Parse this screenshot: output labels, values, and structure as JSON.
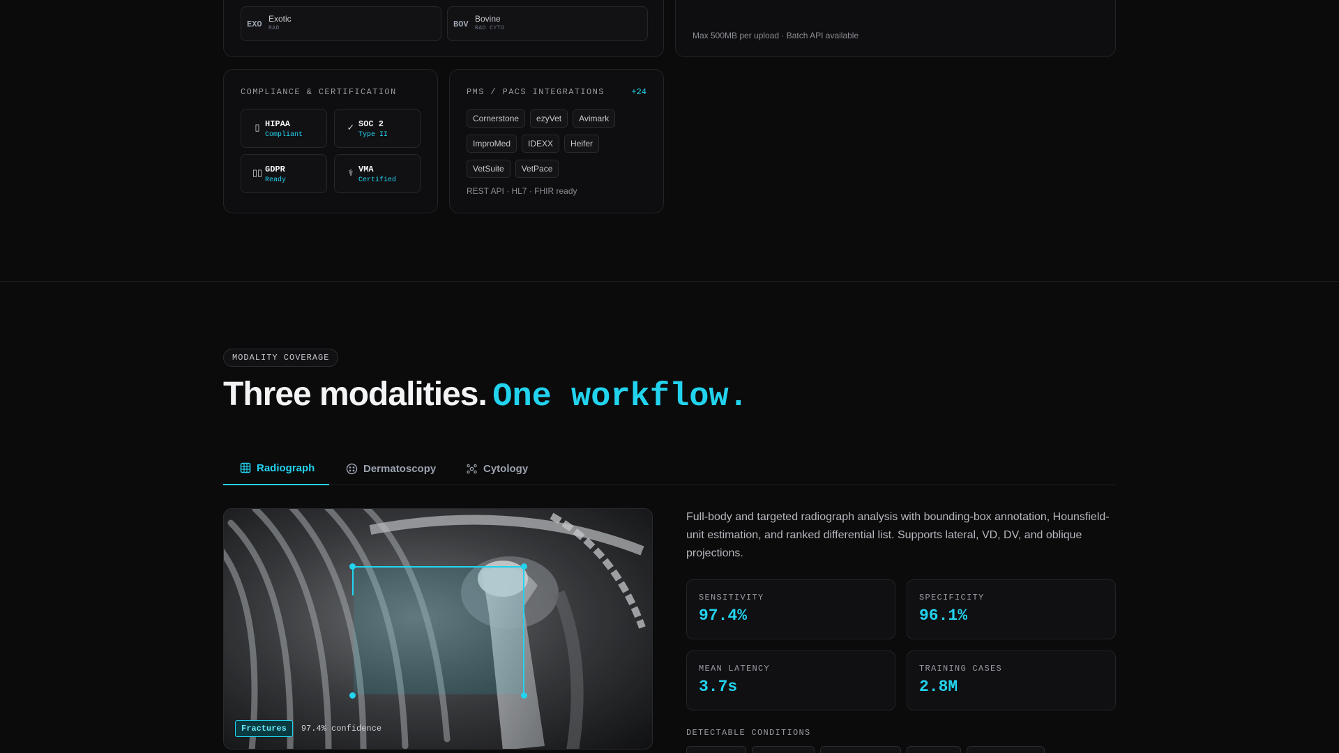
{
  "species": [
    {
      "code": "EXO",
      "name": "Exotic",
      "sub": "RAD"
    },
    {
      "code": "BOV",
      "name": "Bovine",
      "sub": "RAD CYTO"
    }
  ],
  "upload_note": "Max 500MB per upload · Batch API available",
  "compliance": {
    "title": "COMPLIANCE & CERTIFICATION",
    "badges": [
      {
        "icon": "▯",
        "name": "HIPAA",
        "status": "Compliant"
      },
      {
        "icon": "✓",
        "name": "SOC 2",
        "status": "Type II"
      },
      {
        "icon": "▯▯",
        "name": "GDPR",
        "status": "Ready"
      },
      {
        "icon": "⚕",
        "name": "VMA",
        "status": "Certified"
      }
    ]
  },
  "integrations": {
    "title": "PMS / PACS INTEGRATIONS",
    "count": "+24",
    "tags": [
      "Cornerstone",
      "ezyVet",
      "Avimark",
      "ImproMed",
      "IDEXX",
      "Heifer",
      "VetSuite",
      "VetPace"
    ],
    "footnote": "REST API · HL7 · FHIR ready"
  },
  "modality": {
    "eyebrow": "MODALITY COVERAGE",
    "heading_a": "Three modalities.",
    "heading_b": "One workflow.",
    "tabs": [
      {
        "label": "Radiograph",
        "icon": "grid-icon"
      },
      {
        "label": "Dermatoscopy",
        "icon": "derm-icon"
      },
      {
        "label": "Cytology",
        "icon": "cells-icon"
      }
    ],
    "description": "Full-body and targeted radiograph analysis with bounding-box annotation, Hounsfield-unit estimation, and ranked differential list. Supports lateral, VD, DV, and oblique projections.",
    "stats": [
      {
        "label": "SENSITIVITY",
        "value": "97.4%"
      },
      {
        "label": "SPECIFICITY",
        "value": "96.1%"
      },
      {
        "label": "MEAN LATENCY",
        "value": "3.7s"
      },
      {
        "label": "TRAINING CASES",
        "value": "2.8M"
      }
    ],
    "conditions_title": "DETECTABLE CONDITIONS",
    "detection": {
      "label": "Fractures",
      "confidence": "97.4% confidence"
    }
  },
  "colors": {
    "accent": "#22d3ee",
    "bg": "#0b0b0c",
    "card": "#0e0e10",
    "border": "#232428"
  }
}
